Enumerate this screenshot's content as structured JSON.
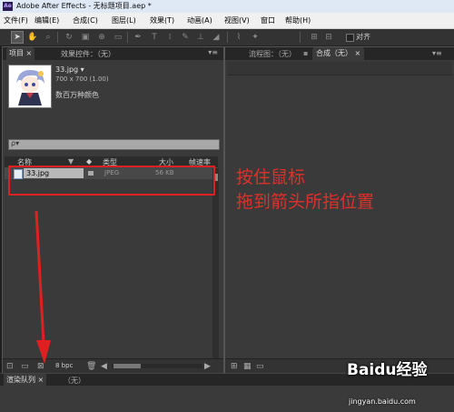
{
  "window": {
    "title": "Adobe After Effects - 无标题项目.aep *"
  },
  "menu": [
    "文件(F)",
    "编辑(E)",
    "合成(C)",
    "图层(L)",
    "效果(T)",
    "动画(A)",
    "视图(V)",
    "窗口",
    "帮助(H)"
  ],
  "toolbar": {
    "align_label": "对齐"
  },
  "project_panel": {
    "tab_project": "项目",
    "tab_close": "×",
    "tab_effects": "效果控件：（无）",
    "menu_glyph": "▾≡",
    "file_name": "33.jpg ▾",
    "dimensions": "700 x 700 (1.00)",
    "color_info": "数百万种颜色",
    "search_icon": "ρ▾",
    "columns": [
      "名称",
      "类型",
      "大小",
      "帧速率"
    ],
    "file": {
      "name": "33.jpg",
      "type": "JPEG",
      "size": "56 KB"
    },
    "bpc": "8 bpc"
  },
  "right_panel": {
    "tab_flow": "流程图：（无）",
    "tab_comp": "合成（无）",
    "tab_close": "×",
    "menu_glyph": "▾≡"
  },
  "render_queue": {
    "tab": "渲染队列 ×",
    "value": "（无）"
  },
  "annotation": {
    "line1": "按住鼠标",
    "line2": "拖到箭头所指位置",
    "color": "#e0302a"
  },
  "watermark": {
    "brand": "Baidu经验",
    "url": "jingyan.baidu.com"
  }
}
